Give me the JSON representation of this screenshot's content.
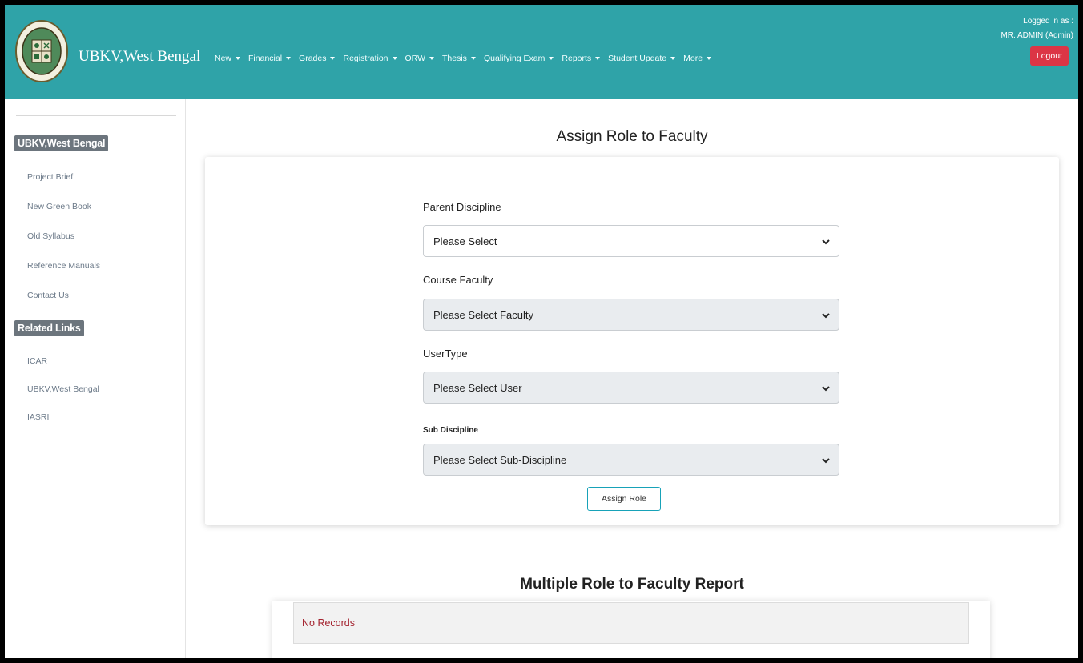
{
  "brand": {
    "name": "UBKV,West Bengal"
  },
  "nav": {
    "items": [
      {
        "label": "New"
      },
      {
        "label": "Financial"
      },
      {
        "label": "Grades"
      },
      {
        "label": "Registration"
      },
      {
        "label": "ORW"
      },
      {
        "label": "Thesis"
      },
      {
        "label": "Qualifying Exam"
      },
      {
        "label": "Reports"
      },
      {
        "label": "Student Update"
      },
      {
        "label": "More"
      }
    ]
  },
  "user": {
    "logged_in_label": "Logged in as :",
    "name": "MR. ADMIN (Admin)",
    "logout_label": "Logout"
  },
  "sidebar": {
    "section1_title": "UBKV,West Bengal",
    "section1_links": [
      "Project Brief",
      "New Green Book",
      "Old Syllabus",
      "Reference Manuals",
      "Contact Us"
    ],
    "section2_title": "Related Links",
    "section2_links": [
      "ICAR",
      "UBKV,West Bengal",
      "IASRI"
    ]
  },
  "form": {
    "title": "Assign Role to Faculty",
    "parent_discipline": {
      "label": "Parent Discipline",
      "value": "Please Select"
    },
    "course_faculty": {
      "label": "Course Faculty",
      "value": "Please Select Faculty"
    },
    "user_type": {
      "label": "UserType",
      "value": "Please Select User"
    },
    "sub_discipline": {
      "label": "Sub Discipline",
      "value": "Please Select Sub-Discipline"
    },
    "submit_label": "Assign Role"
  },
  "report": {
    "title": "Multiple Role to Faculty Report",
    "empty_text": "No Records"
  },
  "colors": {
    "header": "#2fa3a8",
    "logout": "#dc3545",
    "no_records_text": "#a4232f",
    "badge": "#6c757d"
  }
}
